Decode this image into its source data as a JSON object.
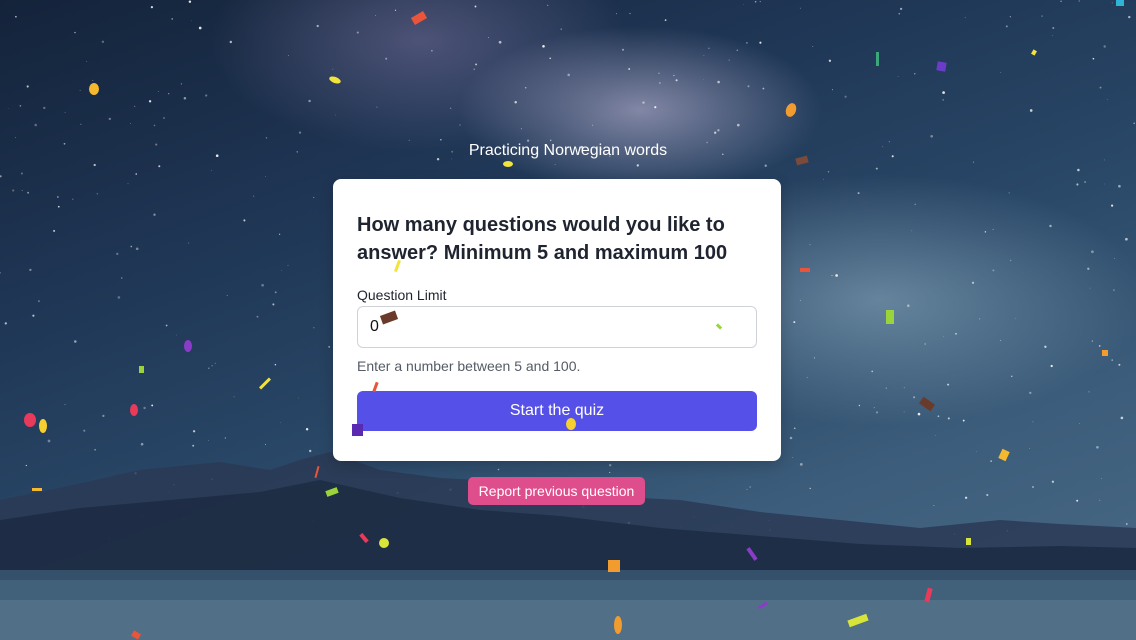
{
  "page": {
    "heading": "Practicing Norwegian words"
  },
  "quiz_card": {
    "title": "How many questions would you like to answer? Minimum 5 and maximum 100",
    "field_label": "Question Limit",
    "input_value": "0",
    "help_text": "Enter a number between 5 and 100.",
    "start_label": "Start the quiz"
  },
  "report": {
    "label": "Report previous question"
  },
  "colors": {
    "start_button": "#5551e8",
    "report_button": "#df4e8c",
    "card_background": "#ffffff"
  }
}
